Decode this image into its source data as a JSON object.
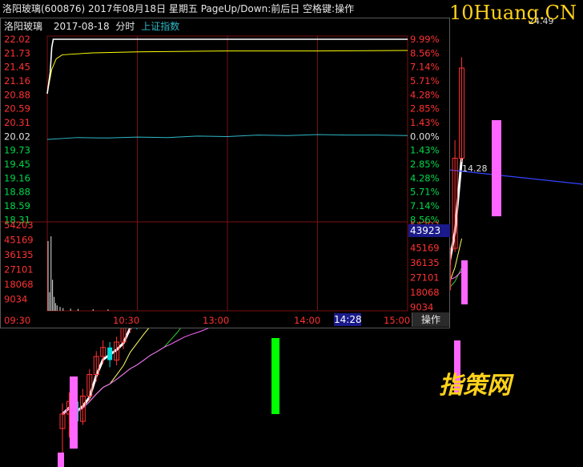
{
  "title_bar": {
    "text": "洛阳玻璃(600876) 2017年08月18日 星期五 PageUp/Down:前后日 空格键:操作"
  },
  "watermark_top": "10Huang.CN",
  "watermark_bottom": "指策网",
  "kline_labels": {
    "top_price": "24.49",
    "side_price": "14.28"
  },
  "popup": {
    "stock_name": "洛阳玻璃",
    "date": "2017-08-18",
    "mode": "分时",
    "index_link": "上证指数",
    "current_volume": "43923",
    "current_time": "14:28",
    "operate_button": "操作"
  },
  "colors": {
    "up": "#ff3232",
    "down": "#00d84a",
    "neutral": "#ffffff",
    "price_line": "#ffffff",
    "avg_line": "#ffff00",
    "index_line": "#2fb8c8",
    "grid": "#7a1010",
    "magenta": "#ff66ff"
  },
  "chart_data": [
    {
      "type": "line",
      "title": "洛阳玻璃 2017-08-18 分时",
      "price_ticks": [
        "22.02",
        "21.73",
        "21.45",
        "21.16",
        "20.88",
        "20.59",
        "20.31",
        "20.02",
        "19.73",
        "19.45",
        "19.16",
        "18.88",
        "18.59",
        "18.31"
      ],
      "pct_ticks": [
        "9.99%",
        "8.56%",
        "7.14%",
        "5.71%",
        "4.28%",
        "2.85%",
        "1.43%",
        "0.00%",
        "1.43%",
        "2.85%",
        "4.28%",
        "5.71%",
        "7.14%",
        "8.56%"
      ],
      "ylim": [
        18.02,
        22.02
      ],
      "prev_close": 20.02,
      "volume_ticks": [
        "54203",
        "45169",
        "36135",
        "27101",
        "18068",
        "9034"
      ],
      "volume_max": 54203,
      "time_labels": [
        "09:30",
        "10:30",
        "13:00",
        "14:00",
        "15:00"
      ],
      "series": [
        {
          "name": "price",
          "x": [
            0,
            2,
            3,
            4,
            5,
            240
          ],
          "values": [
            20.9,
            21.35,
            21.85,
            22.02,
            22.02,
            22.02
          ]
        },
        {
          "name": "average",
          "x": [
            0,
            3,
            6,
            10,
            30,
            60,
            120,
            180,
            240
          ],
          "values": [
            20.9,
            21.4,
            21.62,
            21.7,
            21.74,
            21.76,
            21.78,
            21.78,
            21.79
          ]
        },
        {
          "name": "index",
          "x": [
            0,
            20,
            40,
            60,
            80,
            100,
            120,
            140,
            160,
            180,
            200,
            220,
            240
          ],
          "values": [
            19.96,
            20.0,
            19.99,
            20.01,
            20.0,
            20.03,
            20.02,
            20.05,
            20.04,
            20.06,
            20.05,
            20.05,
            20.04
          ]
        }
      ],
      "volume": {
        "x": [
          0,
          1,
          2,
          3,
          4,
          5,
          6,
          8,
          10,
          15,
          20,
          30,
          40
        ],
        "values": [
          45000,
          12000,
          48000,
          20000,
          9000,
          5000,
          3500,
          2500,
          1800,
          1400,
          1200,
          1000,
          900
        ]
      }
    },
    {
      "type": "candlestick",
      "candles": [
        [
          80,
          88,
          60,
          94,
          "up"
        ],
        [
          88,
          95,
          75,
          100,
          "up"
        ],
        [
          95,
          84,
          80,
          99,
          "down"
        ],
        [
          84,
          98,
          82,
          102,
          "up"
        ],
        [
          98,
          110,
          95,
          113,
          "up"
        ],
        [
          110,
          120,
          106,
          123,
          "up"
        ],
        [
          120,
          125,
          116,
          129,
          "up"
        ],
        [
          125,
          118,
          114,
          128,
          "down"
        ],
        [
          118,
          128,
          115,
          131,
          "up"
        ],
        [
          128,
          136,
          124,
          140,
          "up"
        ],
        [
          136,
          143,
          133,
          146,
          "up"
        ],
        [
          143,
          138,
          135,
          146,
          "down"
        ],
        [
          138,
          150,
          136,
          153,
          "up"
        ],
        [
          150,
          157,
          146,
          160,
          "up"
        ],
        [
          157,
          151,
          148,
          159,
          "down"
        ],
        [
          151,
          160,
          148,
          163,
          "up"
        ],
        [
          160,
          155,
          152,
          163,
          "down"
        ],
        [
          155,
          162,
          152,
          165,
          "up"
        ],
        [
          162,
          166,
          158,
          169,
          "up"
        ],
        [
          166,
          160,
          157,
          168,
          "down"
        ],
        [
          160,
          157,
          154,
          163,
          "down"
        ],
        [
          157,
          165,
          154,
          168,
          "up"
        ],
        [
          165,
          170,
          162,
          173,
          "up"
        ],
        [
          170,
          172,
          166,
          176,
          "up"
        ],
        [
          172,
          181,
          169,
          184,
          "up"
        ],
        [
          181,
          187,
          178,
          190,
          "up"
        ],
        [
          187,
          181,
          178,
          189,
          "down"
        ],
        [
          181,
          182,
          178,
          185,
          "neutral"
        ],
        [
          182,
          190,
          179,
          193,
          "up"
        ],
        [
          190,
          176,
          172,
          193,
          "down"
        ],
        [
          176,
          174,
          170,
          180,
          "down"
        ],
        [
          174,
          178,
          170,
          181,
          "up"
        ],
        [
          178,
          173,
          170,
          181,
          "down"
        ],
        [
          173,
          165,
          162,
          176,
          "down"
        ],
        [
          165,
          168,
          160,
          171,
          "up"
        ],
        [
          168,
          171,
          165,
          174,
          "up"
        ],
        [
          171,
          164,
          160,
          173,
          "down"
        ],
        [
          164,
          160,
          158,
          167,
          "down"
        ],
        [
          160,
          163,
          157,
          166,
          "up"
        ],
        [
          163,
          159,
          157,
          166,
          "down"
        ],
        [
          159,
          156,
          155,
          162,
          "down"
        ],
        [
          156,
          160,
          154,
          163,
          "up"
        ],
        [
          160,
          161,
          157,
          164,
          "up"
        ],
        [
          161,
          157,
          154,
          163,
          "down"
        ],
        [
          157,
          150,
          148,
          160,
          "down"
        ],
        [
          150,
          155,
          147,
          158,
          "up"
        ],
        [
          155,
          158,
          152,
          161,
          "up"
        ],
        [
          158,
          154,
          151,
          161,
          "down"
        ],
        [
          154,
          156,
          151,
          159,
          "up"
        ],
        [
          156,
          152,
          149,
          158,
          "down"
        ],
        [
          152,
          148,
          145,
          155,
          "down"
        ],
        [
          148,
          152,
          144,
          155,
          "up"
        ],
        [
          152,
          155,
          149,
          158,
          "up"
        ],
        [
          155,
          150,
          146,
          158,
          "down"
        ],
        [
          150,
          163,
          146,
          166,
          "up"
        ],
        [
          163,
          168,
          158,
          171,
          "up"
        ],
        [
          168,
          157,
          155,
          172,
          "down"
        ],
        [
          157,
          180,
          156,
          190,
          "up"
        ],
        [
          180,
          230,
          178,
          240,
          "up"
        ],
        [
          230,
          280,
          228,
          286,
          "up"
        ]
      ],
      "ylabels": [
        "24.49",
        "14.28"
      ]
    }
  ]
}
